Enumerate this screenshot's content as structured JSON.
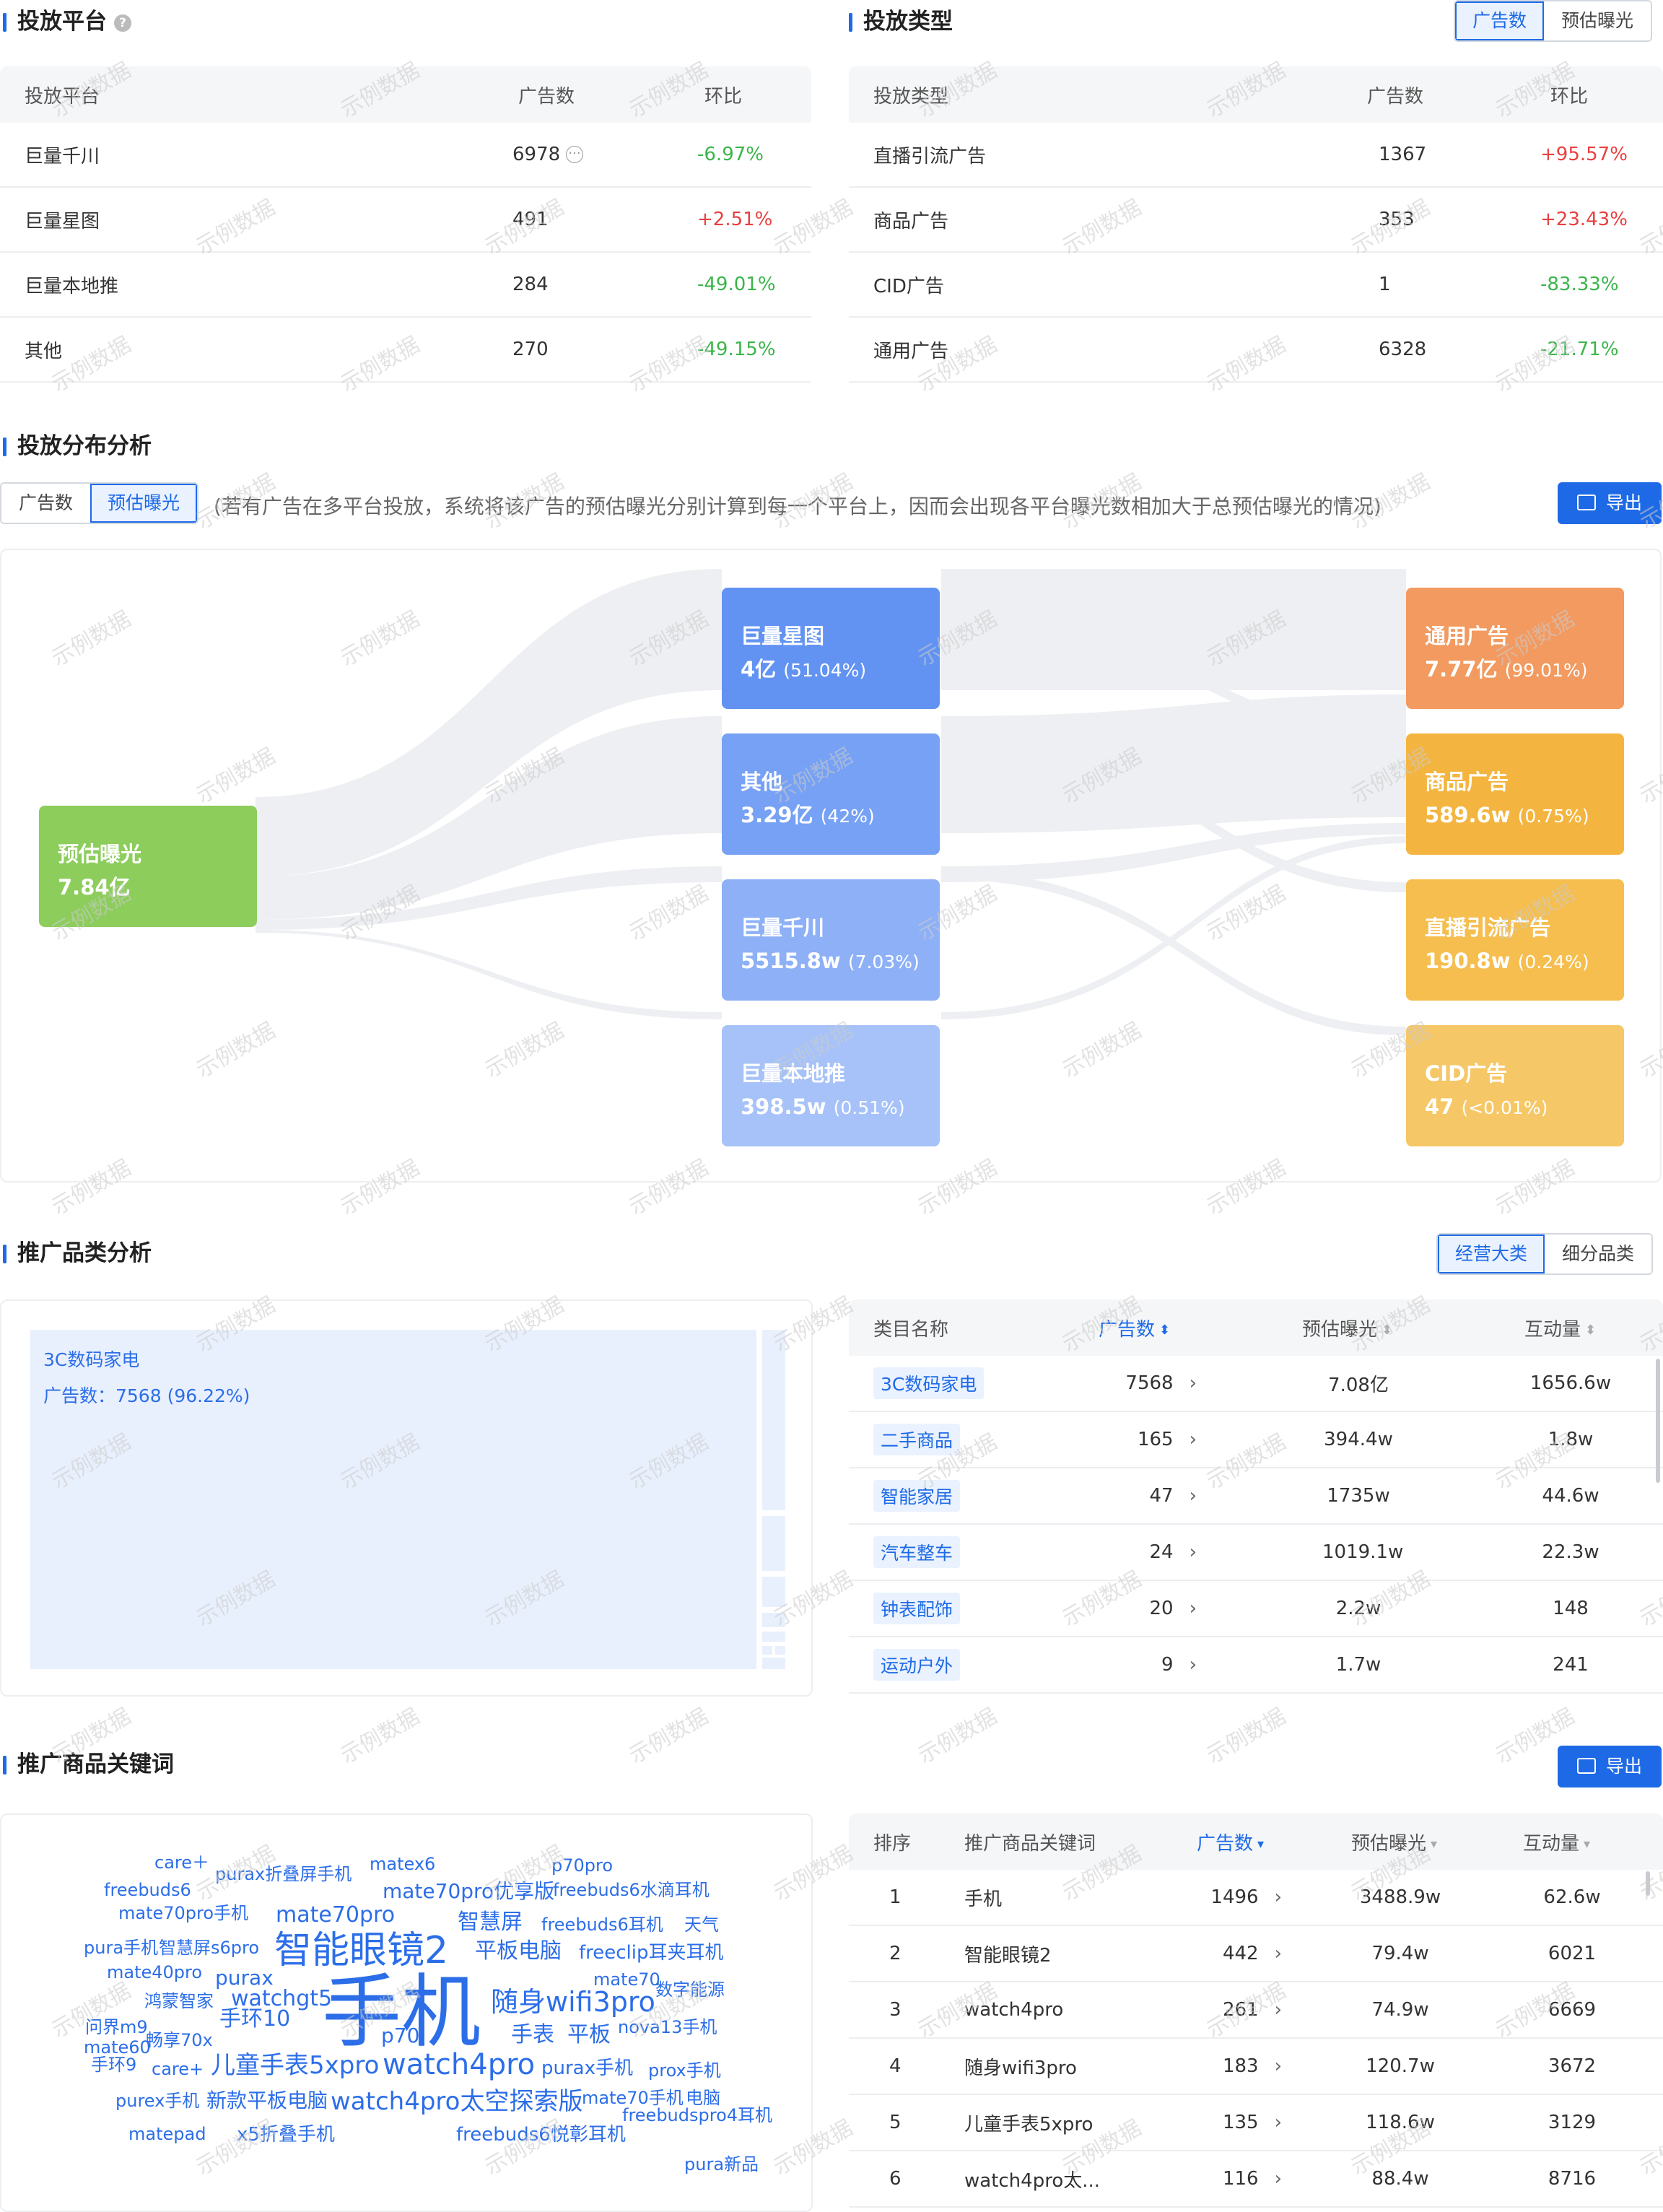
{
  "platform": {
    "title": "投放平台",
    "help_icon": "?",
    "columns": [
      "投放平台",
      "广告数",
      "环比"
    ],
    "rows": [
      {
        "name": "巨量千川",
        "count": "6978",
        "change": "-6.97%",
        "dir": "neg",
        "more": "···"
      },
      {
        "name": "巨量星图",
        "count": "491",
        "change": "+2.51%",
        "dir": "pos"
      },
      {
        "name": "巨量本地推",
        "count": "284",
        "change": "-49.01%",
        "dir": "neg"
      },
      {
        "name": "其他",
        "count": "270",
        "change": "-49.15%",
        "dir": "neg"
      }
    ]
  },
  "adtype": {
    "title": "投放类型",
    "toggle": [
      "广告数",
      "预估曝光"
    ],
    "columns": [
      "投放类型",
      "广告数",
      "环比"
    ],
    "rows": [
      {
        "name": "直播引流广告",
        "count": "1367",
        "change": "+95.57%",
        "dir": "pos"
      },
      {
        "name": "商品广告",
        "count": "353",
        "change": "+23.43%",
        "dir": "pos"
      },
      {
        "name": "CID广告",
        "count": "1",
        "change": "-83.33%",
        "dir": "neg"
      },
      {
        "name": "通用广告",
        "count": "6328",
        "change": "-21.71%",
        "dir": "neg"
      }
    ]
  },
  "distribution": {
    "title": "投放分布分析",
    "toggle": [
      "广告数",
      "预估曝光"
    ],
    "note": "(若有广告在多平台投放，系统将该广告的预估曝光分别计算到每一个平台上，因而会出现各平台曝光数相加大于总预估曝光的情况)",
    "export_label": "导出",
    "source": {
      "name": "预估曝光",
      "value": "7.84亿",
      "color": "#8ccd5c"
    },
    "platforms": [
      {
        "name": "巨量星图",
        "value": "4亿",
        "pct": "(51.04%)",
        "color": "#6293f2"
      },
      {
        "name": "其他",
        "value": "3.29亿",
        "pct": "(42%)",
        "color": "#76a1f4"
      },
      {
        "name": "巨量千川",
        "value": "5515.8w",
        "pct": "(7.03%)",
        "color": "#8db0f6"
      },
      {
        "name": "巨量本地推",
        "value": "398.5w",
        "pct": "(0.51%)",
        "color": "#a6c2f8"
      }
    ],
    "types": [
      {
        "name": "通用广告",
        "value": "7.77亿",
        "pct": "(99.01%)",
        "color": "#f29a5f"
      },
      {
        "name": "商品广告",
        "value": "589.6w",
        "pct": "(0.75%)",
        "color": "#f4b540"
      },
      {
        "name": "直播引流广告",
        "value": "190.8w",
        "pct": "(0.24%)",
        "color": "#f5be4e"
      },
      {
        "name": "CID广告",
        "value": "47",
        "pct": "(<0.01%)",
        "color": "#f6c766"
      }
    ]
  },
  "category": {
    "title": "推广品类分析",
    "toggle": [
      "经营大类",
      "细分品类"
    ],
    "treemap": {
      "name": "3C数码家电",
      "label": "广告数：7568 (96.22%)"
    },
    "columns": [
      "类目名称",
      "广告数",
      "预估曝光",
      "互动量"
    ],
    "rows": [
      {
        "name": "3C数码家电",
        "count": "7568",
        "exposure": "7.08亿",
        "interact": "1656.6w"
      },
      {
        "name": "二手商品",
        "count": "165",
        "exposure": "394.4w",
        "interact": "1.8w"
      },
      {
        "name": "智能家居",
        "count": "47",
        "exposure": "1735w",
        "interact": "44.6w"
      },
      {
        "name": "汽车整车",
        "count": "24",
        "exposure": "1019.1w",
        "interact": "22.3w"
      },
      {
        "name": "钟表配饰",
        "count": "20",
        "exposure": "2.2w",
        "interact": "148"
      },
      {
        "name": "运动户外",
        "count": "9",
        "exposure": "1.7w",
        "interact": "241"
      }
    ]
  },
  "keywords": {
    "title": "推广商品关键词",
    "export_label": "导出",
    "columns": [
      "排序",
      "推广商品关键词",
      "广告数",
      "预估曝光",
      "互动量"
    ],
    "rows": [
      {
        "rank": "1",
        "kw": "手机",
        "count": "1496",
        "exposure": "3488.9w",
        "interact": "62.6w"
      },
      {
        "rank": "2",
        "kw": "智能眼镜2",
        "count": "442",
        "exposure": "79.4w",
        "interact": "6021"
      },
      {
        "rank": "3",
        "kw": "watch4pro",
        "count": "261",
        "exposure": "74.9w",
        "interact": "6669"
      },
      {
        "rank": "4",
        "kw": "随身wifi3pro",
        "count": "183",
        "exposure": "120.7w",
        "interact": "3672"
      },
      {
        "rank": "5",
        "kw": "儿童手表5xpro",
        "count": "135",
        "exposure": "118.6w",
        "interact": "3129"
      },
      {
        "rank": "6",
        "kw": "watch4pro太...",
        "count": "116",
        "exposure": "88.4w",
        "interact": "8716"
      }
    ],
    "cloud": [
      "care＋",
      "purax折叠屏手机",
      "matex6",
      "p70pro",
      "freebuds6",
      "mate70pro优享版",
      "freebuds6水滴耳机",
      "mate70pro手机",
      "mate70pro",
      "智慧屏",
      "freebuds6耳机",
      "天气",
      "pura手机",
      "智慧屏s6pro",
      "智能眼镜2",
      "平板电脑",
      "freeclip耳夹耳机",
      "mate40pro",
      "purax",
      "mate70",
      "鸿蒙智家",
      "watchgt5",
      "手机",
      "随身wifi3pro",
      "数字能源",
      "问界m9",
      "手环10",
      "nova13手机",
      "mate60",
      "畅享70x",
      "p70",
      "手表",
      "平板",
      "手环9",
      "care+",
      "儿童手表5xpro",
      "watch4pro",
      "purax手机",
      "prox手机",
      "purex手机",
      "新款平板电脑",
      "watch4pro太空探索版",
      "mate70手机",
      "电脑",
      "matepad",
      "x5折叠手机",
      "freebuds6悦彰耳机",
      "freebudspro4耳机",
      "pura新品"
    ]
  },
  "watermark": "示例数据"
}
